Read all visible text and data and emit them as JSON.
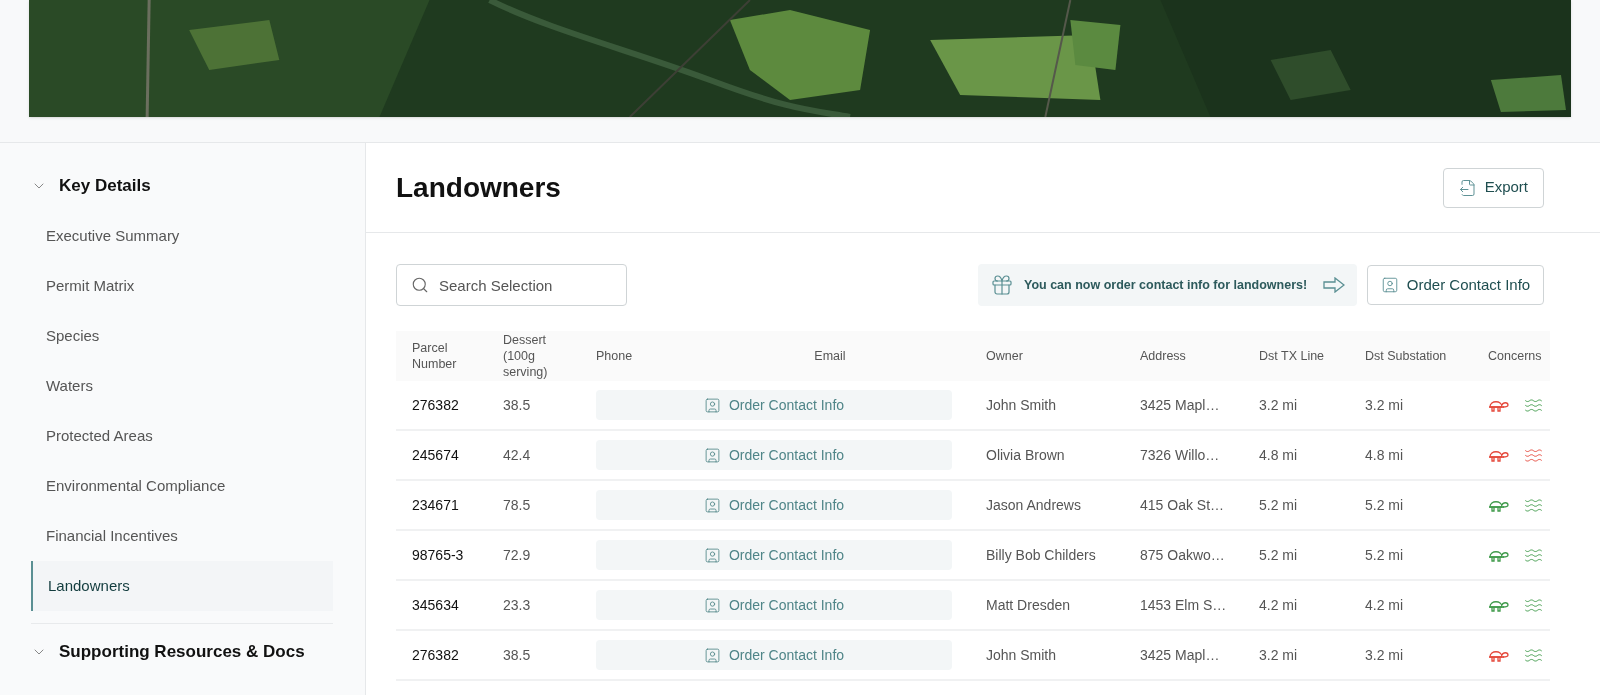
{
  "sidebar": {
    "sections": [
      {
        "title": "Key Details",
        "expanded": true,
        "items": [
          {
            "label": "Executive Summary",
            "selected": false
          },
          {
            "label": "Permit Matrix",
            "selected": false
          },
          {
            "label": "Species",
            "selected": false
          },
          {
            "label": "Waters",
            "selected": false
          },
          {
            "label": "Protected Areas",
            "selected": false
          },
          {
            "label": "Environmental Compliance",
            "selected": false
          },
          {
            "label": "Financial Incentives",
            "selected": false
          },
          {
            "label": "Landowners",
            "selected": true
          }
        ]
      },
      {
        "title": "Supporting Resources & Docs",
        "expanded": true
      }
    ]
  },
  "page": {
    "title": "Landowners",
    "export_button": "Export",
    "search": {
      "placeholder": "Search Selection"
    },
    "banner": "You can now order contact info for landowners!",
    "order_button": "Order Contact Info"
  },
  "table": {
    "columns": [
      "Parcel Number",
      "Dessert (100g serving)",
      "Phone",
      "Email",
      "Owner",
      "Address",
      "Dst TX Line",
      "Dst Substation",
      "Concerns"
    ],
    "rows": [
      {
        "parcel": "276382",
        "dessert": "38.5",
        "contact": "Order Contact Info",
        "owner": "John Smith",
        "address": "3425 Mapl…",
        "tx": "3.2 mi",
        "substation": "3.2 mi",
        "species_alert": true,
        "water_alert": false
      },
      {
        "parcel": "245674",
        "dessert": "42.4",
        "contact": "Order Contact Info",
        "owner": "Olivia Brown",
        "address": "7326 Willo…",
        "tx": "4.8 mi",
        "substation": "4.8 mi",
        "species_alert": true,
        "water_alert": true
      },
      {
        "parcel": "234671",
        "dessert": "78.5",
        "contact": "Order Contact Info",
        "owner": "Jason Andrews",
        "address": "415 Oak St…",
        "tx": "5.2 mi",
        "substation": "5.2 mi",
        "species_alert": false,
        "water_alert": false
      },
      {
        "parcel": "98765-3",
        "dessert": "72.9",
        "contact": "Order Contact Info",
        "owner": "Billy Bob Childers",
        "address": "875 Oakwo…",
        "tx": "5.2 mi",
        "substation": "5.2 mi",
        "species_alert": false,
        "water_alert": false
      },
      {
        "parcel": "345634",
        "dessert": "23.3",
        "contact": "Order Contact Info",
        "owner": "Matt Dresden",
        "address": "1453 Elm S…",
        "tx": "4.2 mi",
        "substation": "4.2 mi",
        "species_alert": false,
        "water_alert": false
      },
      {
        "parcel": "276382",
        "dessert": "38.5",
        "contact": "Order Contact Info",
        "owner": "John Smith",
        "address": "3425 Mapl…",
        "tx": "3.2 mi",
        "substation": "3.2 mi",
        "species_alert": true,
        "water_alert": false
      }
    ]
  }
}
